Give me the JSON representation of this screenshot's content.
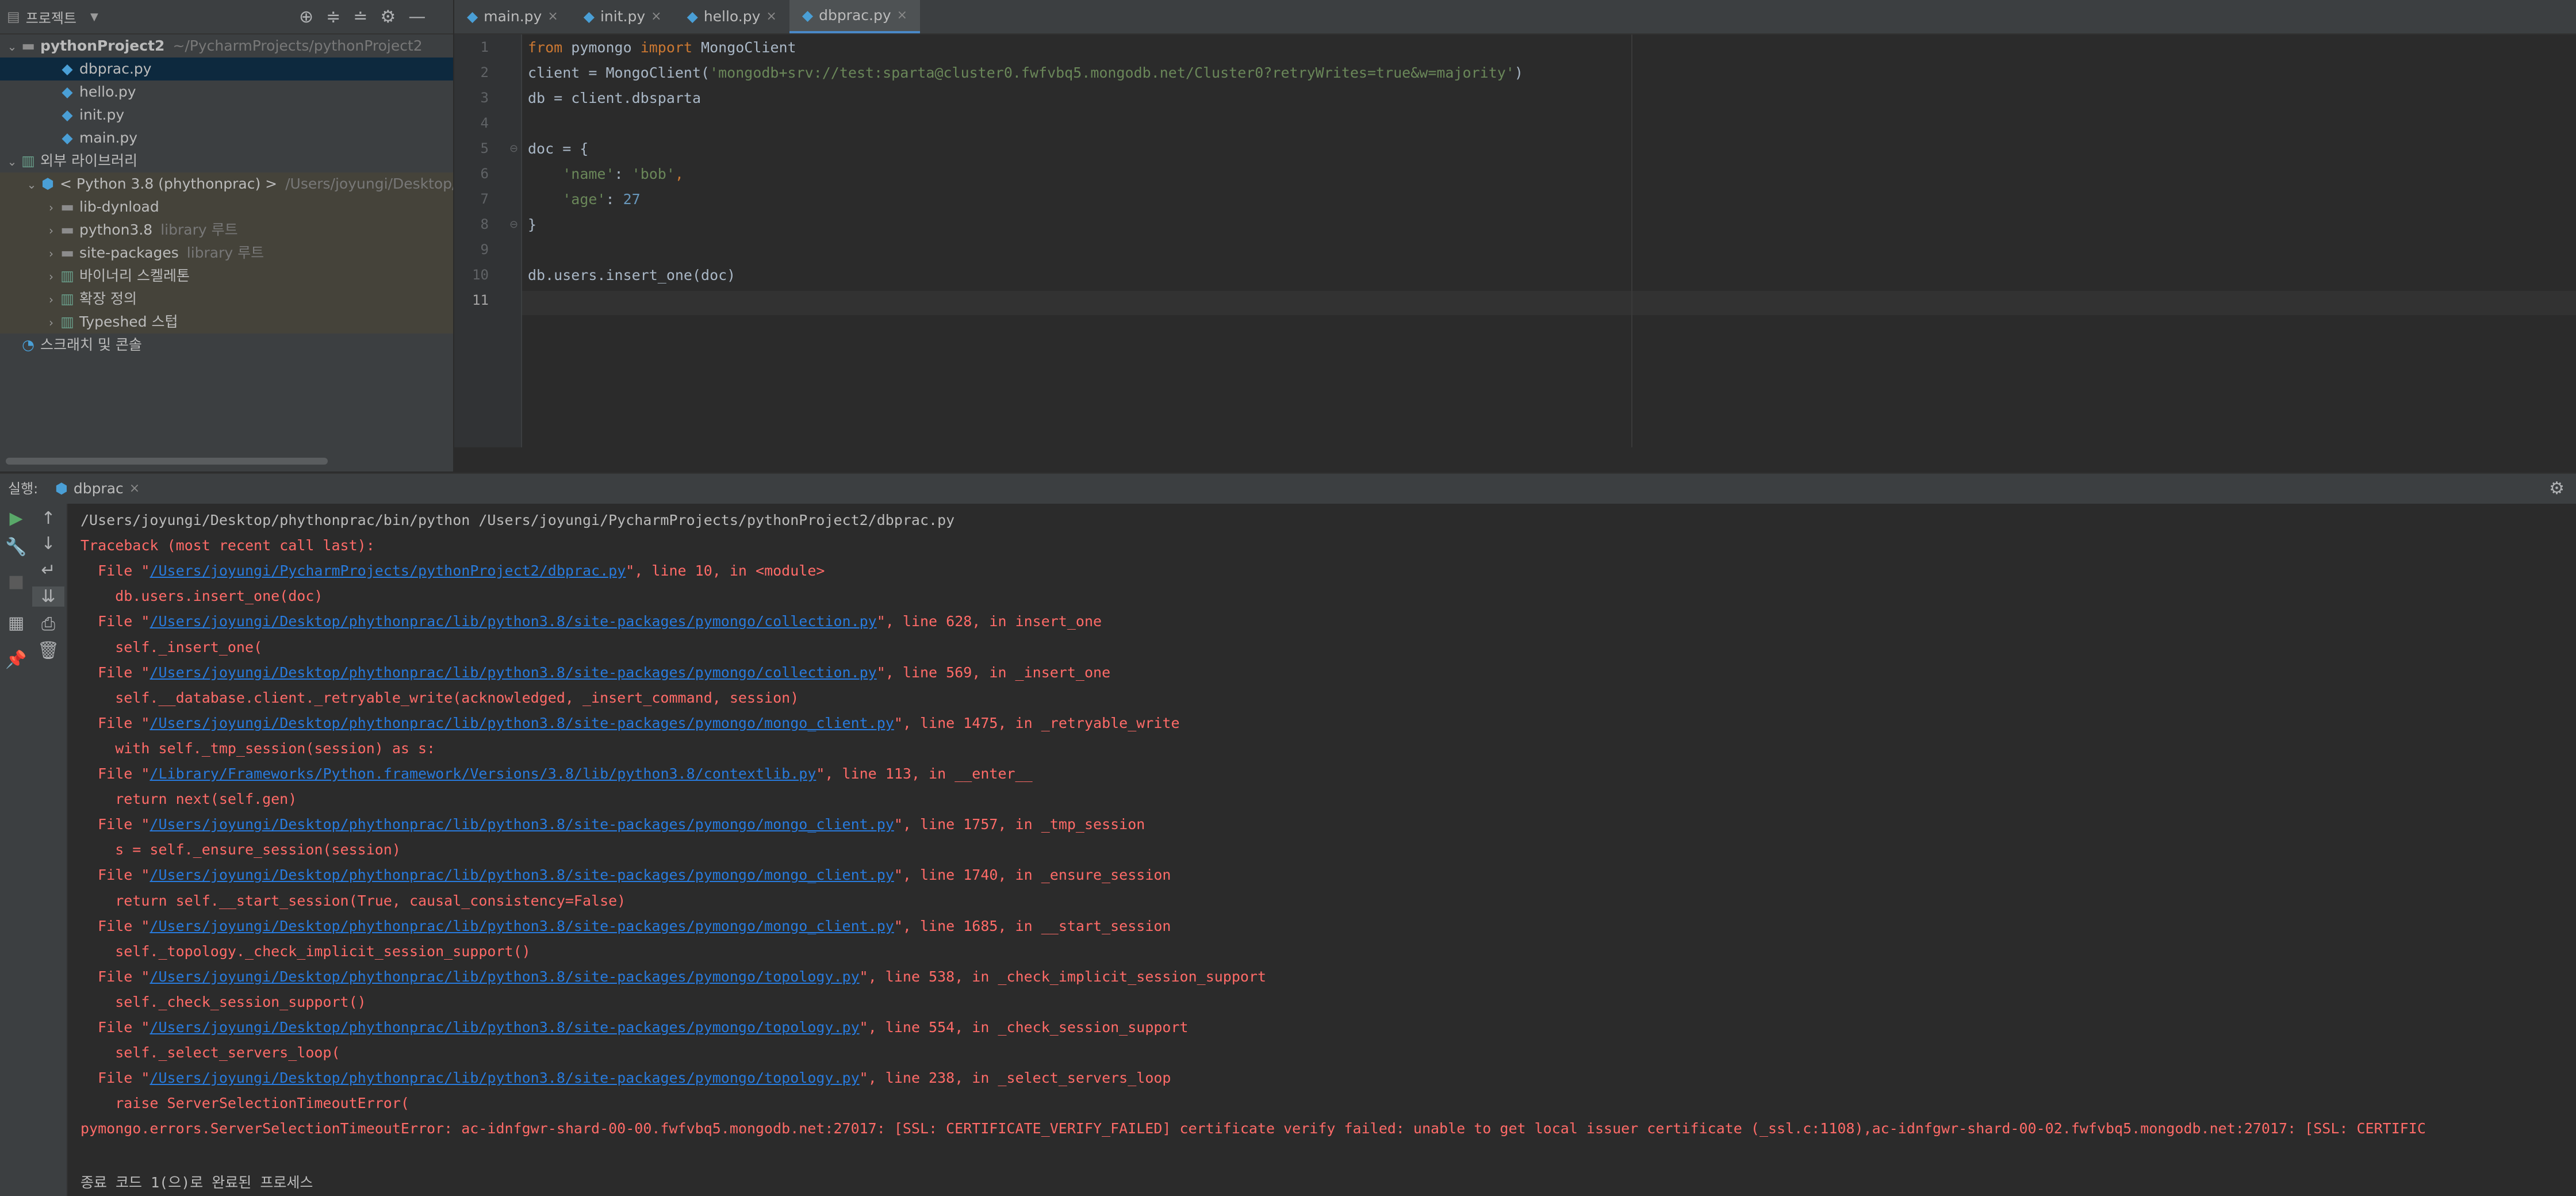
{
  "project_panel": {
    "title": "프로젝트",
    "tree": [
      {
        "label": "pythonProject2",
        "muted": "~/PycharmProjects/pythonProject2",
        "arrow": "⌄",
        "icon": "folder-icon",
        "depth": 0
      },
      {
        "label": "dbprac.py",
        "muted": "",
        "arrow": "",
        "icon": "python-file-icon",
        "depth": 2,
        "selected": true
      },
      {
        "label": "hello.py",
        "muted": "",
        "arrow": "",
        "icon": "python-file-icon",
        "depth": 2
      },
      {
        "label": "init.py",
        "muted": "",
        "arrow": "",
        "icon": "python-file-icon",
        "depth": 2
      },
      {
        "label": "main.py",
        "muted": "",
        "arrow": "",
        "icon": "python-file-icon",
        "depth": 2
      },
      {
        "label": "외부 라이브러리",
        "muted": "",
        "arrow": "⌄",
        "icon": "library-icon",
        "depth": 0
      },
      {
        "label": "< Python 3.8 (phythonprac) >",
        "muted": "/Users/joyungi/Desktop/p",
        "arrow": "⌄",
        "icon": "python-sdk-icon",
        "depth": 1,
        "lib": true
      },
      {
        "label": "lib-dynload",
        "muted": "",
        "arrow": "›",
        "icon": "folder-icon",
        "depth": 2,
        "lib": true
      },
      {
        "label": "python3.8",
        "muted": "library 루트",
        "arrow": "›",
        "icon": "folder-icon",
        "depth": 2,
        "lib": true
      },
      {
        "label": "site-packages",
        "muted": "library 루트",
        "arrow": "›",
        "icon": "folder-icon",
        "depth": 2,
        "lib": true
      },
      {
        "label": "바이너리 스켈레톤",
        "muted": "",
        "arrow": "›",
        "icon": "library-icon",
        "depth": 2,
        "lib": true
      },
      {
        "label": "확장 정의",
        "muted": "",
        "arrow": "›",
        "icon": "library-icon",
        "depth": 2,
        "lib": true
      },
      {
        "label": "Typeshed 스텁",
        "muted": "",
        "arrow": "›",
        "icon": "library-icon",
        "depth": 2,
        "lib": true
      },
      {
        "label": "스크래치 및 콘솔",
        "muted": "",
        "arrow": "",
        "icon": "scratch-icon",
        "depth": 0
      }
    ]
  },
  "tabs": [
    {
      "label": "main.py",
      "active": false
    },
    {
      "label": "init.py",
      "active": false
    },
    {
      "label": "hello.py",
      "active": false
    },
    {
      "label": "dbprac.py",
      "active": true
    }
  ],
  "editor": {
    "current_line": 11,
    "lines": [
      [
        {
          "t": "from ",
          "c": "kw"
        },
        {
          "t": "pymongo ",
          "c": ""
        },
        {
          "t": "import ",
          "c": "kw"
        },
        {
          "t": "MongoClient",
          "c": ""
        }
      ],
      [
        {
          "t": "client = MongoClient(",
          "c": ""
        },
        {
          "t": "'mongodb+srv://test:sparta@cluster0.fwfvbq5.mongodb.net/Cluster0?retryWrites=true&w=majority'",
          "c": "str"
        },
        {
          "t": ")",
          "c": ""
        }
      ],
      [
        {
          "t": "db = client.dbsparta",
          "c": ""
        }
      ],
      [],
      [
        {
          "t": "doc = {",
          "c": ""
        }
      ],
      [
        {
          "t": "    ",
          "c": ""
        },
        {
          "t": "'name'",
          "c": "str"
        },
        {
          "t": ": ",
          "c": ""
        },
        {
          "t": "'bob'",
          "c": "str"
        },
        {
          "t": ",",
          "c": "kw"
        }
      ],
      [
        {
          "t": "    ",
          "c": ""
        },
        {
          "t": "'age'",
          "c": "str"
        },
        {
          "t": ": ",
          "c": ""
        },
        {
          "t": "27",
          "c": "num"
        }
      ],
      [
        {
          "t": "}",
          "c": ""
        }
      ],
      [],
      [
        {
          "t": "db.users.insert_one(doc)",
          "c": ""
        }
      ],
      []
    ]
  },
  "run_panel": {
    "label": "실행:",
    "tab": "dbprac",
    "console": [
      {
        "parts": [
          {
            "t": "/Users/joyungi/Desktop/phythonprac/bin/python /Users/joyungi/PycharmProjects/pythonProject2/dbprac.py"
          }
        ],
        "kind": "normal"
      },
      {
        "parts": [
          {
            "t": "Traceback (most recent call last):"
          }
        ],
        "kind": "err"
      },
      {
        "parts": [
          {
            "t": "  File \""
          },
          {
            "t": "/Users/joyungi/PycharmProjects/pythonProject2/dbprac.py",
            "link": true
          },
          {
            "t": "\", line 10, in <module>"
          }
        ],
        "kind": "err"
      },
      {
        "parts": [
          {
            "t": "    db.users.insert_one(doc)"
          }
        ],
        "kind": "err"
      },
      {
        "parts": [
          {
            "t": "  File \""
          },
          {
            "t": "/Users/joyungi/Desktop/phythonprac/lib/python3.8/site-packages/pymongo/collection.py",
            "link": true
          },
          {
            "t": "\", line 628, in insert_one"
          }
        ],
        "kind": "err"
      },
      {
        "parts": [
          {
            "t": "    self._insert_one("
          }
        ],
        "kind": "err"
      },
      {
        "parts": [
          {
            "t": "  File \""
          },
          {
            "t": "/Users/joyungi/Desktop/phythonprac/lib/python3.8/site-packages/pymongo/collection.py",
            "link": true
          },
          {
            "t": "\", line 569, in _insert_one"
          }
        ],
        "kind": "err"
      },
      {
        "parts": [
          {
            "t": "    self.__database.client._retryable_write(acknowledged, _insert_command, session)"
          }
        ],
        "kind": "err"
      },
      {
        "parts": [
          {
            "t": "  File \""
          },
          {
            "t": "/Users/joyungi/Desktop/phythonprac/lib/python3.8/site-packages/pymongo/mongo_client.py",
            "link": true
          },
          {
            "t": "\", line 1475, in _retryable_write"
          }
        ],
        "kind": "err"
      },
      {
        "parts": [
          {
            "t": "    with self._tmp_session(session) as s:"
          }
        ],
        "kind": "err"
      },
      {
        "parts": [
          {
            "t": "  File \""
          },
          {
            "t": "/Library/Frameworks/Python.framework/Versions/3.8/lib/python3.8/contextlib.py",
            "link": true
          },
          {
            "t": "\", line 113, in __enter__"
          }
        ],
        "kind": "err"
      },
      {
        "parts": [
          {
            "t": "    return next(self.gen)"
          }
        ],
        "kind": "err"
      },
      {
        "parts": [
          {
            "t": "  File \""
          },
          {
            "t": "/Users/joyungi/Desktop/phythonprac/lib/python3.8/site-packages/pymongo/mongo_client.py",
            "link": true
          },
          {
            "t": "\", line 1757, in _tmp_session"
          }
        ],
        "kind": "err"
      },
      {
        "parts": [
          {
            "t": "    s = self._ensure_session(session)"
          }
        ],
        "kind": "err"
      },
      {
        "parts": [
          {
            "t": "  File \""
          },
          {
            "t": "/Users/joyungi/Desktop/phythonprac/lib/python3.8/site-packages/pymongo/mongo_client.py",
            "link": true
          },
          {
            "t": "\", line 1740, in _ensure_session"
          }
        ],
        "kind": "err"
      },
      {
        "parts": [
          {
            "t": "    return self.__start_session(True, causal_consistency=False)"
          }
        ],
        "kind": "err"
      },
      {
        "parts": [
          {
            "t": "  File \""
          },
          {
            "t": "/Users/joyungi/Desktop/phythonprac/lib/python3.8/site-packages/pymongo/mongo_client.py",
            "link": true
          },
          {
            "t": "\", line 1685, in __start_session"
          }
        ],
        "kind": "err"
      },
      {
        "parts": [
          {
            "t": "    self._topology._check_implicit_session_support()"
          }
        ],
        "kind": "err"
      },
      {
        "parts": [
          {
            "t": "  File \""
          },
          {
            "t": "/Users/joyungi/Desktop/phythonprac/lib/python3.8/site-packages/pymongo/topology.py",
            "link": true
          },
          {
            "t": "\", line 538, in _check_implicit_session_support"
          }
        ],
        "kind": "err"
      },
      {
        "parts": [
          {
            "t": "    self._check_session_support()"
          }
        ],
        "kind": "err"
      },
      {
        "parts": [
          {
            "t": "  File \""
          },
          {
            "t": "/Users/joyungi/Desktop/phythonprac/lib/python3.8/site-packages/pymongo/topology.py",
            "link": true
          },
          {
            "t": "\", line 554, in _check_session_support"
          }
        ],
        "kind": "err"
      },
      {
        "parts": [
          {
            "t": "    self._select_servers_loop("
          }
        ],
        "kind": "err"
      },
      {
        "parts": [
          {
            "t": "  File \""
          },
          {
            "t": "/Users/joyungi/Desktop/phythonprac/lib/python3.8/site-packages/pymongo/topology.py",
            "link": true
          },
          {
            "t": "\", line 238, in _select_servers_loop"
          }
        ],
        "kind": "err"
      },
      {
        "parts": [
          {
            "t": "    raise ServerSelectionTimeoutError("
          }
        ],
        "kind": "err"
      },
      {
        "parts": [
          {
            "t": "pymongo.errors.ServerSelectionTimeoutError: ac-idnfgwr-shard-00-00.fwfvbq5.mongodb.net:27017: [SSL: CERTIFICATE_VERIFY_FAILED] certificate verify failed: unable to get local issuer certificate (_ssl.c:1108),ac-idnfgwr-shard-00-02.fwfvbq5.mongodb.net:27017: [SSL: CERTIFIC"
          }
        ],
        "kind": "err"
      },
      {
        "parts": [
          {
            "t": ""
          }
        ],
        "kind": "normal"
      },
      {
        "parts": [
          {
            "t": "종료 코드 1(으)로 완료된 프로세스"
          }
        ],
        "kind": "normal"
      }
    ]
  }
}
